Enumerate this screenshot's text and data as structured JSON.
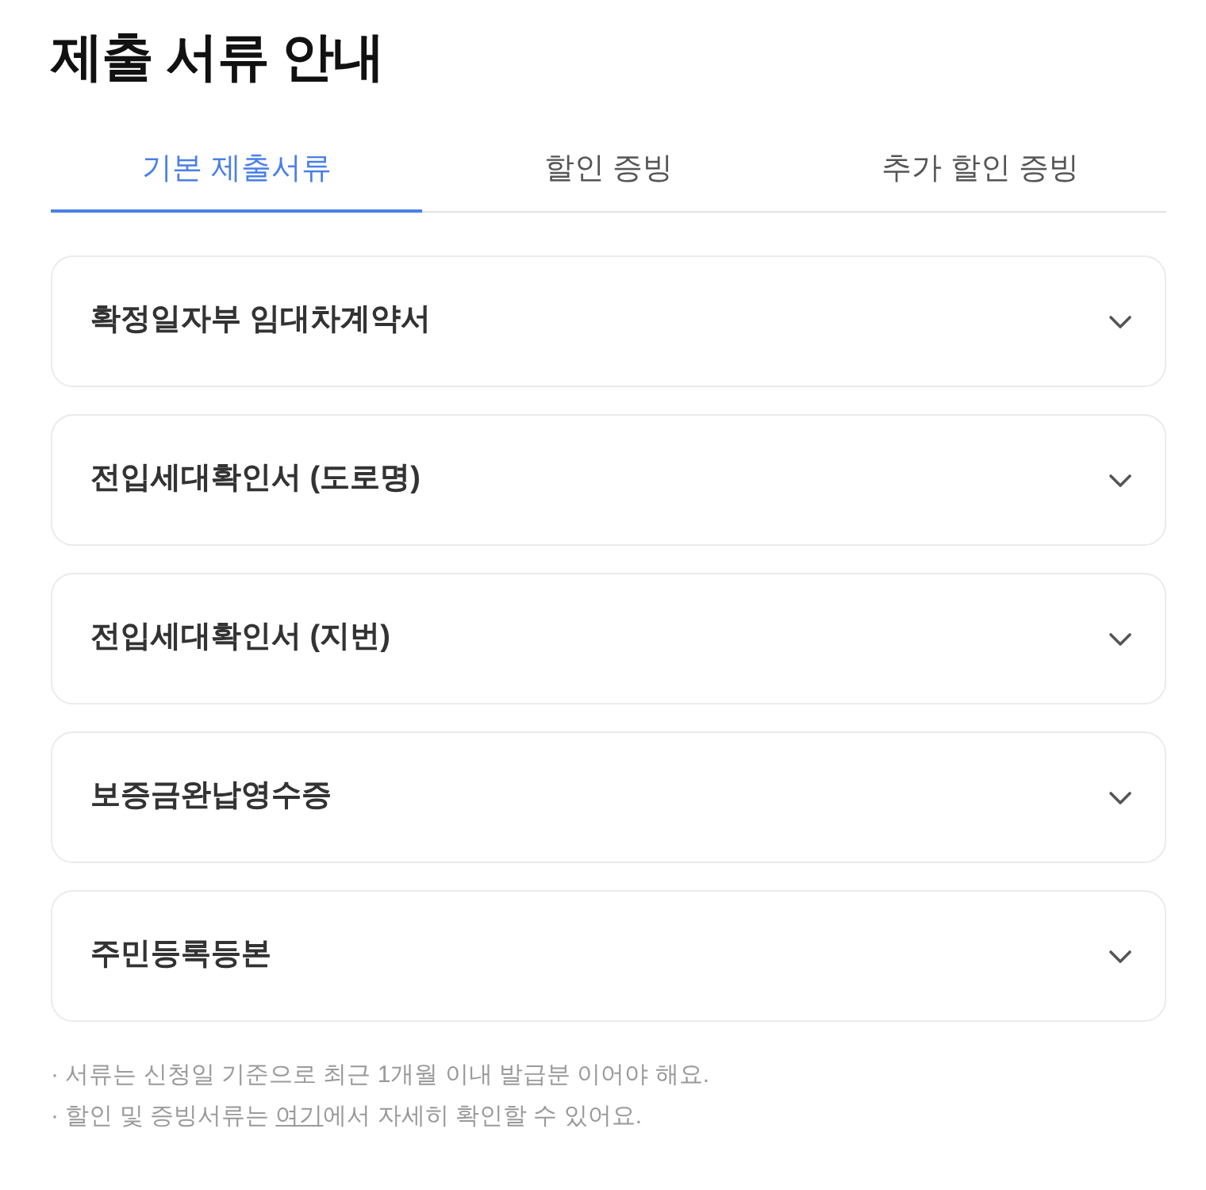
{
  "title": "제출 서류 안내",
  "tabs": [
    {
      "label": "기본 제출서류",
      "selected": true
    },
    {
      "label": "할인 증빙",
      "selected": false
    },
    {
      "label": "추가 할인 증빙",
      "selected": false
    }
  ],
  "documents": [
    {
      "title": "확정일자부 임대차계약서",
      "expanded": false
    },
    {
      "title": "전입세대확인서 (도로명)",
      "expanded": false
    },
    {
      "title": "전입세대확인서 (지번)",
      "expanded": false
    },
    {
      "title": "보증금완납영수증",
      "expanded": false
    },
    {
      "title": "주민등록등본",
      "expanded": false
    }
  ],
  "notes": [
    {
      "text": "· 서류는 신청일 기준으로 최근 1개월 이내 발급분 이어야 해요."
    },
    {
      "text": "· 할인 및 증빙서류는 ",
      "link": "여기",
      "text_after": "에서 자세히 확인할 수 있어요."
    }
  ]
}
